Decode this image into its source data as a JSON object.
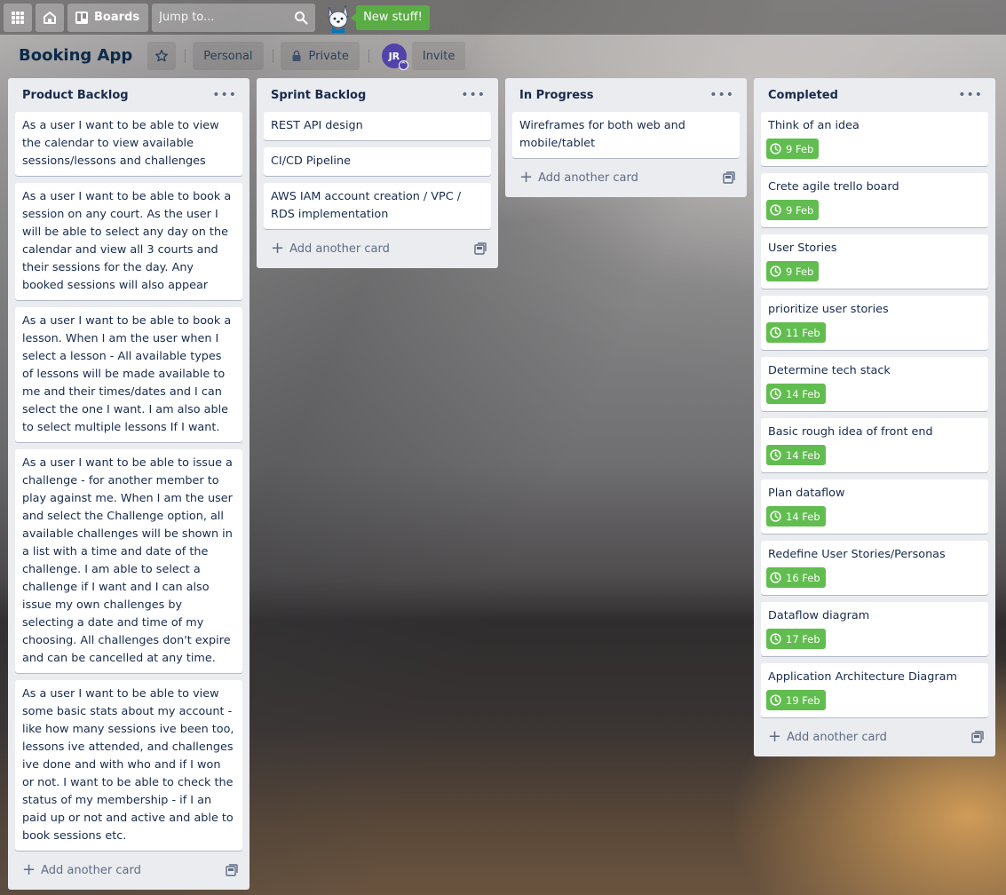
{
  "nav": {
    "boards_label": "Boards",
    "search_placeholder": "Jump to...",
    "new_stuff_label": "New stuff!"
  },
  "board": {
    "title": "Booking App",
    "visibility_team": "Personal",
    "visibility_privacy": "Private",
    "member_initials": "JR",
    "invite_label": "Invite"
  },
  "add_card_label": "Add another card",
  "lists": [
    {
      "title": "Product Backlog",
      "cards": [
        {
          "text": "As a user I want to be able to view the calendar to view available sessions/lessons and challenges"
        },
        {
          "text": "As a user I want to be able to book a session on any court. As the user I will be able to select any day on the calendar and view all 3 courts and their sessions for the day. Any booked sessions will also appear"
        },
        {
          "text": "As a user I want to be able to book a lesson. When I am the user when I select a lesson - All available types of lessons will be made available to me and their times/dates and I can select the one I want. I am also able to select multiple lessons If I want."
        },
        {
          "text": "As a user I want to be able to issue a challenge - for another member to play against me. When I am the user and select the Challenge option, all available challenges will be shown in a list with a time and date of the challenge. I am able to select a challenge if I want and I can also issue my own challenges by selecting a date and time of my choosing. All challenges don't expire and can be cancelled at any time."
        },
        {
          "text": "As a user I want to be able to view some basic stats about my account - like how many sessions ive been too, lessons ive attended, and challenges ive done and with who and if I won or not. I want to be able to check the status of my membership - if I an paid up or not and active and able to book sessions etc."
        }
      ]
    },
    {
      "title": "Sprint Backlog",
      "cards": [
        {
          "text": "REST API design"
        },
        {
          "text": "CI/CD Pipeline"
        },
        {
          "text": "AWS IAM account creation / VPC / RDS implementation"
        }
      ]
    },
    {
      "title": "In Progress",
      "cards": [
        {
          "text": "Wireframes for both web and mobile/tablet"
        }
      ]
    },
    {
      "title": "Completed",
      "cards": [
        {
          "text": "Think of an idea",
          "due": "9 Feb"
        },
        {
          "text": "Crete agile trello board",
          "due": "9 Feb"
        },
        {
          "text": "User Stories",
          "due": "9 Feb"
        },
        {
          "text": "prioritize user stories",
          "due": "11 Feb"
        },
        {
          "text": "Determine tech stack",
          "due": "14 Feb"
        },
        {
          "text": "Basic rough idea of front end",
          "due": "14 Feb"
        },
        {
          "text": "Plan dataflow",
          "due": "14 Feb"
        },
        {
          "text": "Redefine User Stories/Personas",
          "due": "16 Feb"
        },
        {
          "text": "Dataflow diagram",
          "due": "17 Feb"
        },
        {
          "text": "Application Architecture Diagram",
          "due": "19 Feb"
        }
      ]
    }
  ],
  "colors": {
    "due_complete": "#61bd4f",
    "new_stuff": "#5aac44",
    "avatar": "#5243aa",
    "list_bg": "#ebecf0"
  }
}
